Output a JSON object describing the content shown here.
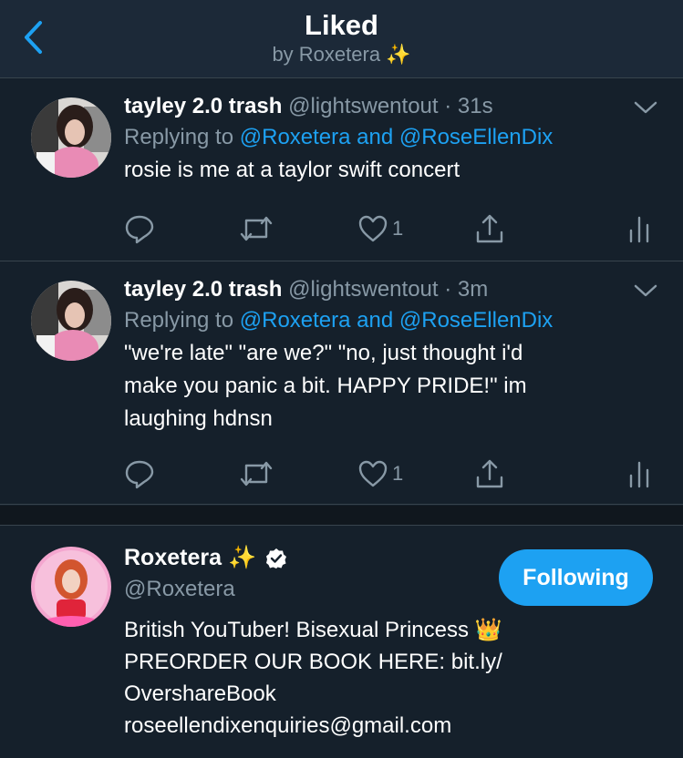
{
  "header": {
    "title": "Liked",
    "subtitle": "by Roxetera ✨"
  },
  "tweets": [
    {
      "name": "tayley 2.0 trash",
      "handle": "@lightswentout",
      "sep": "·",
      "time": "31s",
      "replying_prefix": "Replying to",
      "replying_to": "@Roxetera and @RoseEllenDix",
      "lines": [
        "rosie is me at a taylor swift concert"
      ],
      "like_count": "1"
    },
    {
      "name": "tayley 2.0 trash",
      "handle": "@lightswentout",
      "sep": "·",
      "time": "3m",
      "replying_prefix": "Replying to",
      "replying_to": "@Roxetera and @RoseEllenDix",
      "lines": [
        "\"we're late\" \"are we?\" \"no, just thought i'd",
        "make you panic a bit. HAPPY PRIDE!\" im",
        "laughing hdnsn"
      ],
      "like_count": "1"
    }
  ],
  "profile": {
    "name": "Roxetera ✨",
    "handle": "@Roxetera",
    "follow_label": "Following",
    "bio_lines": [
      "British YouTuber! Bisexual Princess 👑",
      "PREORDER OUR BOOK HERE: bit.ly/",
      "OvershareBook",
      "roseellendixenquiries@gmail.com"
    ]
  },
  "colors": {
    "background": "#15202b",
    "header_bg": "#1c2938",
    "accent": "#1da1f2",
    "muted": "#8899a6",
    "divider": "#38444d"
  },
  "icons": [
    "back-chevron-icon",
    "caret-down-icon",
    "reply-icon",
    "retweet-icon",
    "like-heart-icon",
    "share-icon",
    "analytics-icon",
    "verified-badge-icon",
    "crown-icon",
    "sparkles-icon"
  ]
}
